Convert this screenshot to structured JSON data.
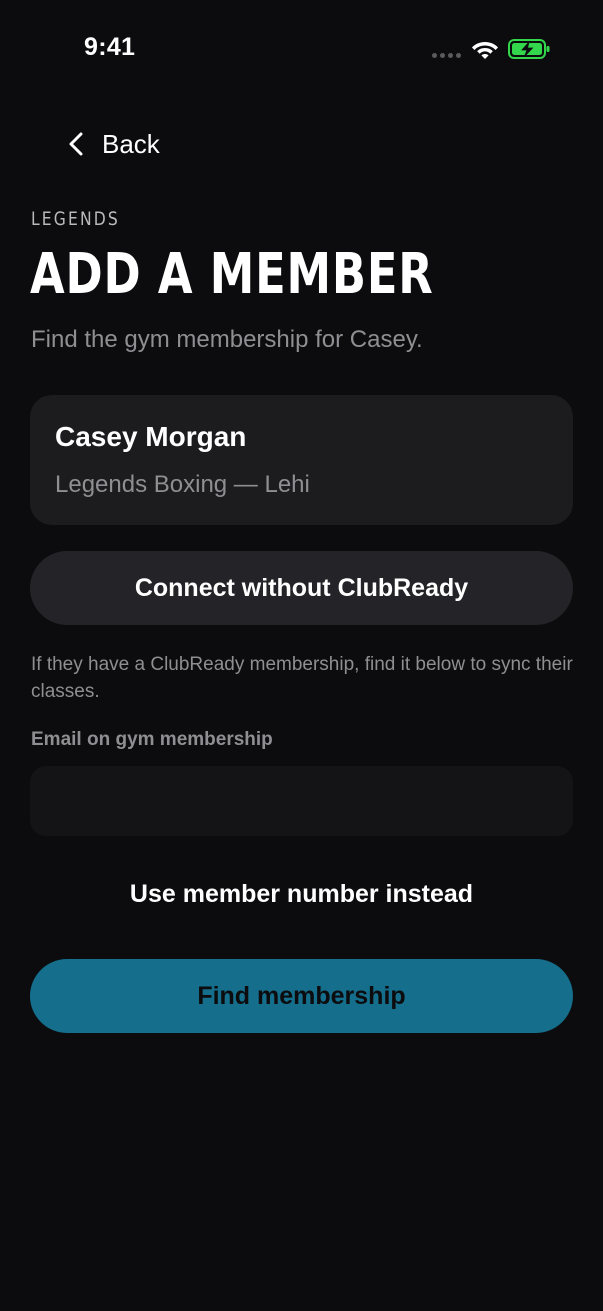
{
  "status_bar": {
    "time": "9:41",
    "icons": [
      "cellular-signal-icon",
      "wifi-icon",
      "battery-charging-icon"
    ],
    "battery_color": "#32d74b"
  },
  "nav": {
    "back_label": "Back",
    "back_icon": "chevron-left-icon"
  },
  "header": {
    "brand": "LEGENDS",
    "title": "ADD A MEMBER",
    "subtitle": "Find the gym membership for Casey."
  },
  "member_card": {
    "name": "Casey Morgan",
    "gym": "Legends Boxing — Lehi"
  },
  "actions": {
    "connect_without_label": "Connect without ClubReady",
    "helper_text": "If they have a ClubReady membership, find it below to sync their classes.",
    "email_label": "Email on gym membership",
    "email_value": "",
    "member_number_link": "Use member number instead",
    "find_button_label": "Find membership"
  },
  "colors": {
    "background": "#0c0c0e",
    "card": "#1c1c1f",
    "secondary_button": "#242428",
    "accent": "#146e8c",
    "muted_text": "#8e8e93"
  }
}
